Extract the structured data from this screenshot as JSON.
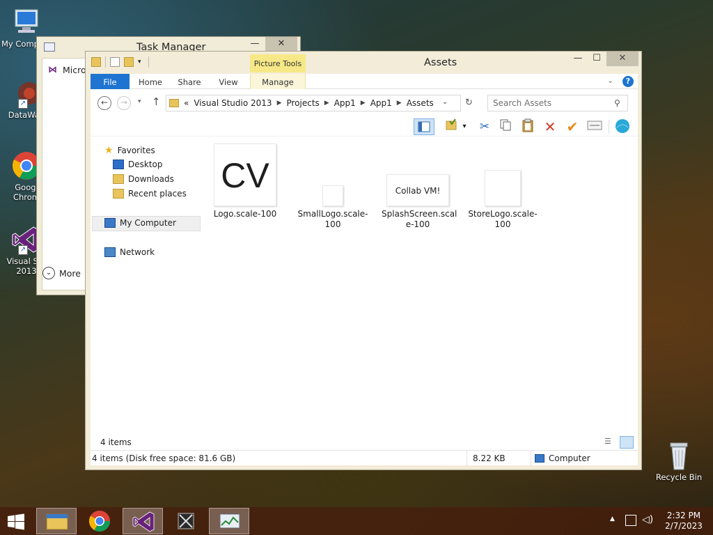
{
  "desktop_icons": [
    {
      "label": "My Comp",
      "icon": "computer-icon"
    },
    {
      "label": "DataWag",
      "icon": "datawagon-icon"
    },
    {
      "label": "Googl\nChrom",
      "icon": "chrome-icon"
    },
    {
      "label": "Visual Stu\n2013",
      "icon": "visual-studio-icon"
    },
    {
      "label": "Recycle Bin",
      "icon": "recycle-bin-icon"
    }
  ],
  "task_manager": {
    "title": "Task Manager",
    "process_label": "Micros",
    "more_label": "More",
    "minimize_glyph": "—",
    "close_glyph": "✕"
  },
  "explorer": {
    "title": "Assets",
    "contextual_tab": "Picture Tools",
    "tabs": [
      "File",
      "Home",
      "Share",
      "View",
      "Manage"
    ],
    "address": {
      "prefix": "«",
      "crumbs": [
        "Visual Studio 2013",
        "Projects",
        "App1",
        "App1",
        "Assets"
      ]
    },
    "search_placeholder": "Search Assets",
    "nav": {
      "favorites": "Favorites",
      "desktop": "Desktop",
      "downloads": "Downloads",
      "recent": "Recent places",
      "computer": "My Computer",
      "network": "Network"
    },
    "files": [
      {
        "name": "Logo.scale-100",
        "thumb_text": "CV"
      },
      {
        "name": "SmallLogo.scale-\n100",
        "thumb_text": ""
      },
      {
        "name": "SplashScreen.scal\ne-100",
        "thumb_text": "Collab VM!"
      },
      {
        "name": "StoreLogo.scale-\n100",
        "thumb_text": ""
      }
    ],
    "item_count": "4 items",
    "status": {
      "summary": "4 items (Disk free space: 81.6 GB)",
      "size": "8.22 KB",
      "location": "Computer"
    },
    "controls": {
      "minimize": "—",
      "maximize": "☐",
      "close": "✕"
    }
  },
  "taskbar": {
    "time": "2:32 PM",
    "date": "2/7/2023",
    "accent": "#1e74d0"
  }
}
